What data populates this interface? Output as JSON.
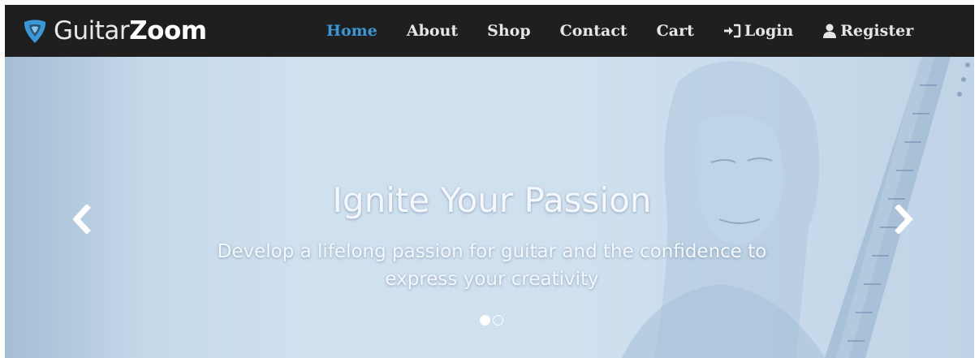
{
  "brand": {
    "name_light": "Guitar",
    "name_bold": "Zoom",
    "icon": "guitar-pick-icon",
    "pick_color": "#3a98d8"
  },
  "nav": {
    "items": [
      {
        "label": "Home",
        "active": true
      },
      {
        "label": "About"
      },
      {
        "label": "Shop"
      },
      {
        "label": "Contact"
      },
      {
        "label": "Cart"
      },
      {
        "label": "Login",
        "icon": "sign-in-icon"
      },
      {
        "label": "Register",
        "icon": "user-icon"
      }
    ],
    "active_color": "#3a98d8",
    "bar_color": "#1f1f1f"
  },
  "hero": {
    "title": "Ignite Your Passion",
    "subtitle_line1": "Develop a lifelong passion for guitar and the confidence to",
    "subtitle_line2": "express your creativity",
    "prev_icon": "chevron-left-icon",
    "next_icon": "chevron-right-icon",
    "slides_total": 2,
    "slide_active": 1
  }
}
